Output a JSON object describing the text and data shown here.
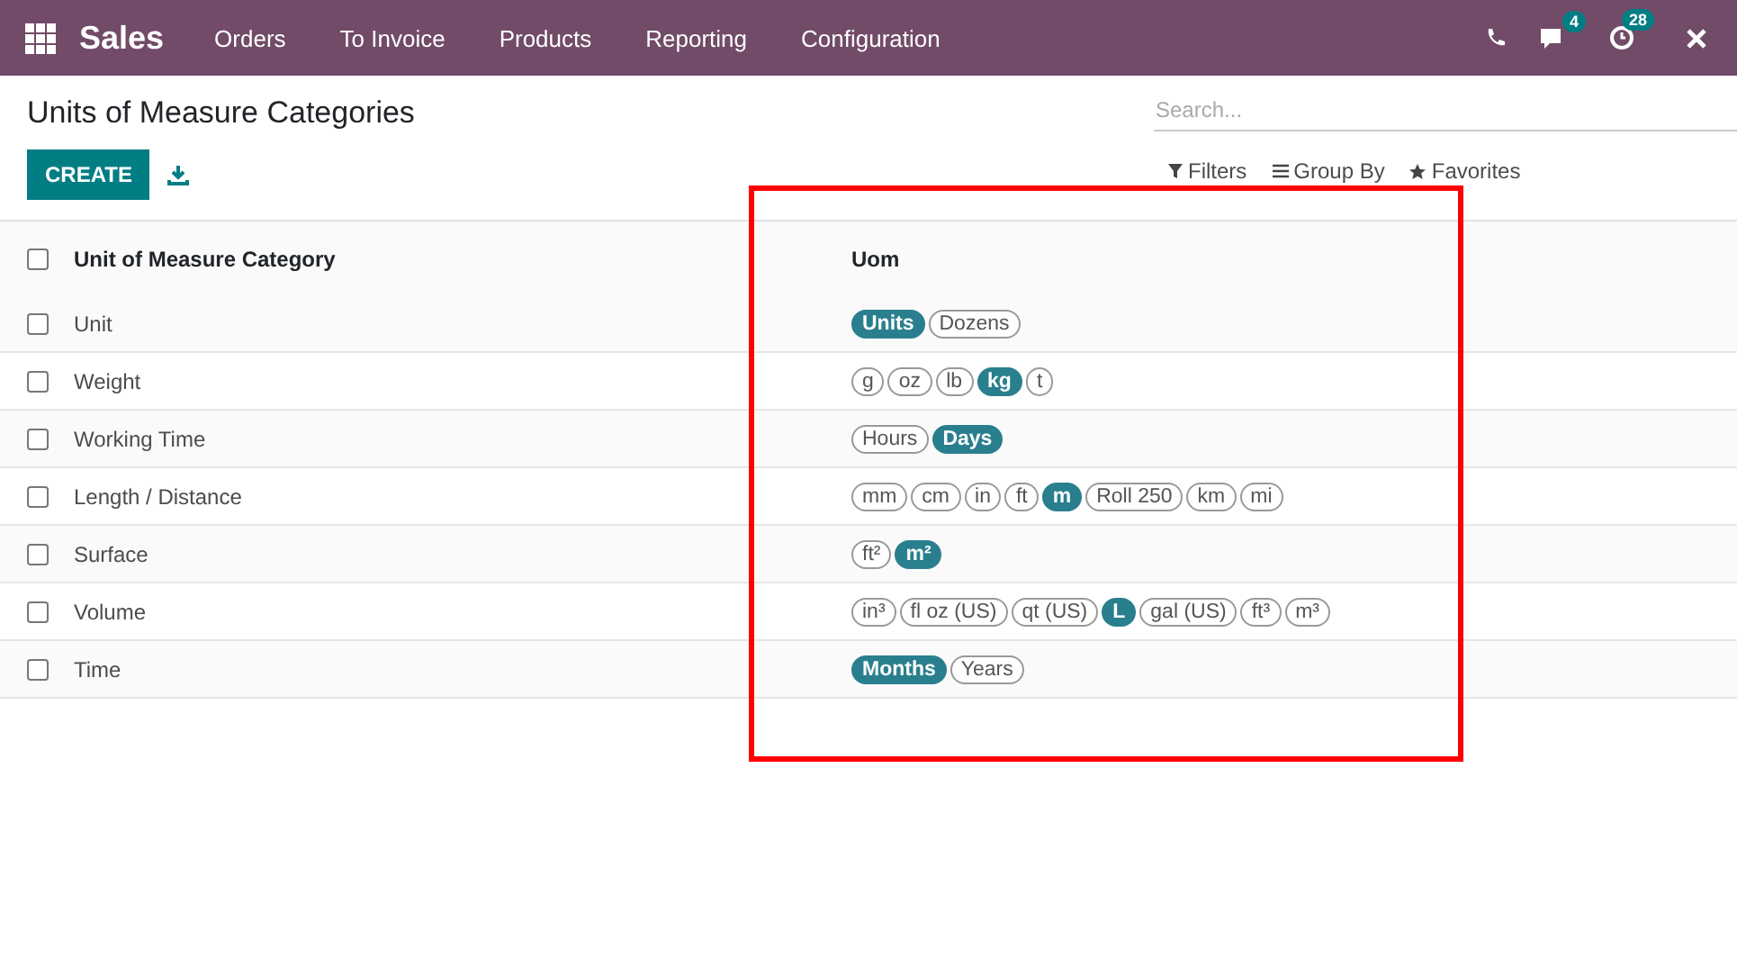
{
  "navbar": {
    "app": "Sales",
    "menu": [
      "Orders",
      "To Invoice",
      "Products",
      "Reporting",
      "Configuration"
    ],
    "messages_badge": "4",
    "activities_badge": "28"
  },
  "control_panel": {
    "title": "Units of Measure Categories",
    "create": "CREATE",
    "search": {
      "placeholder": "Search..."
    },
    "filters": "Filters",
    "group_by": "Group By",
    "favorites": "Favorites"
  },
  "table": {
    "all_checked": false,
    "columns": [
      "Unit of Measure Category",
      "Uom"
    ],
    "rows": [
      {
        "name": "Unit",
        "checked": false,
        "uoms": [
          {
            "label": "Units",
            "selected": true
          },
          {
            "label": "Dozens",
            "selected": false
          }
        ]
      },
      {
        "name": "Weight",
        "checked": false,
        "uoms": [
          {
            "label": "g",
            "selected": false
          },
          {
            "label": "oz",
            "selected": false
          },
          {
            "label": "lb",
            "selected": false
          },
          {
            "label": "kg",
            "selected": true
          },
          {
            "label": "t",
            "selected": false
          }
        ]
      },
      {
        "name": "Working Time",
        "checked": false,
        "uoms": [
          {
            "label": "Hours",
            "selected": false
          },
          {
            "label": "Days",
            "selected": true
          }
        ]
      },
      {
        "name": "Length / Distance",
        "checked": false,
        "uoms": [
          {
            "label": "mm",
            "selected": false
          },
          {
            "label": "cm",
            "selected": false
          },
          {
            "label": "in",
            "selected": false
          },
          {
            "label": "ft",
            "selected": false
          },
          {
            "label": "m",
            "selected": true
          },
          {
            "label": "Roll 250",
            "selected": false
          },
          {
            "label": "km",
            "selected": false
          },
          {
            "label": "mi",
            "selected": false
          }
        ]
      },
      {
        "name": "Surface",
        "checked": false,
        "uoms": [
          {
            "label": "ft²",
            "selected": false
          },
          {
            "label": "m²",
            "selected": true
          }
        ]
      },
      {
        "name": "Volume",
        "checked": false,
        "uoms": [
          {
            "label": "in³",
            "selected": false
          },
          {
            "label": "fl oz (US)",
            "selected": false
          },
          {
            "label": "qt (US)",
            "selected": false
          },
          {
            "label": "L",
            "selected": true
          },
          {
            "label": "gal (US)",
            "selected": false
          },
          {
            "label": "ft³",
            "selected": false
          },
          {
            "label": "m³",
            "selected": false
          }
        ]
      },
      {
        "name": "Time",
        "checked": false,
        "uoms": [
          {
            "label": "Months",
            "selected": true
          },
          {
            "label": "Years",
            "selected": false
          }
        ]
      }
    ]
  }
}
